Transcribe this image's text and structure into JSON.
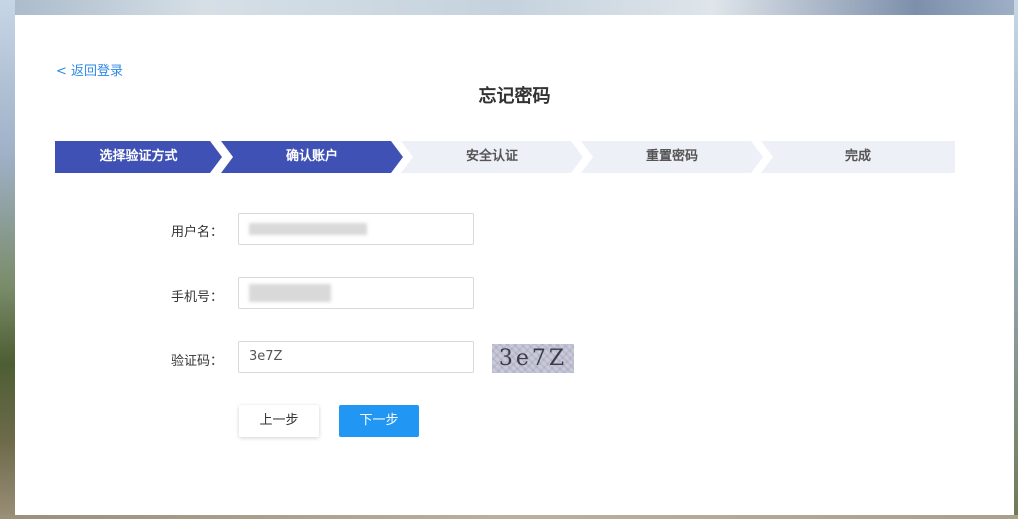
{
  "page": {
    "back_link": "< 返回登录",
    "title": "忘记密码"
  },
  "steps": [
    {
      "label": "选择验证方式",
      "state": "done"
    },
    {
      "label": "确认账户",
      "state": "current"
    },
    {
      "label": "安全认证",
      "state": "pending"
    },
    {
      "label": "重置密码",
      "state": "pending"
    },
    {
      "label": "完成",
      "state": "pending"
    }
  ],
  "form": {
    "username_label": "用户名：",
    "phone_label": "手机号：",
    "captcha_label": "验证码：",
    "captcha_value": "3e7Z",
    "captcha_image_text": "3e7Z"
  },
  "buttons": {
    "prev": "上一步",
    "next": "下一步"
  },
  "colors": {
    "active_step": "#3f51b5",
    "inactive_step": "#eef0f7",
    "primary_button": "#2196f3",
    "link": "#2e8ae6"
  }
}
